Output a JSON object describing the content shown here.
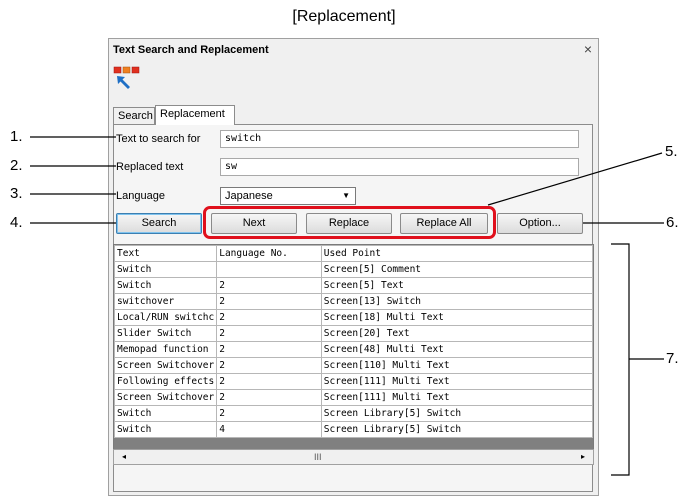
{
  "caption": "[Replacement]",
  "dialog": {
    "title": "Text Search and Replacement",
    "close_symbol": "×",
    "tabs": [
      "Search",
      "Replacement"
    ]
  },
  "form": {
    "search_label": "Text to search for",
    "search_value": "switch",
    "replaced_label": "Replaced text",
    "replaced_value": "sw",
    "language_label": "Language",
    "language_value": "Japanese"
  },
  "buttons": {
    "search": "Search",
    "next": "Next",
    "replace": "Replace",
    "replace_all": "Replace All",
    "option": "Option..."
  },
  "table": {
    "headers": [
      "Text",
      "Language No.",
      "Used Point"
    ],
    "rows": [
      [
        "Switch",
        "",
        "Screen[5] Comment"
      ],
      [
        "Switch",
        "2",
        "Screen[5] Text"
      ],
      [
        "switchover",
        "2",
        "Screen[13] Switch"
      ],
      [
        "Local/RUN switchc",
        "2",
        "Screen[18] Multi Text"
      ],
      [
        "Slider Switch",
        "2",
        "Screen[20] Text"
      ],
      [
        "Memopad function",
        "2",
        "Screen[48] Multi Text"
      ],
      [
        "Screen Switchover",
        "2",
        "Screen[110] Multi Text"
      ],
      [
        "Following effects",
        "2",
        "Screen[111] Multi Text"
      ],
      [
        "Screen Switchover",
        "2",
        "Screen[111] Multi Text"
      ],
      [
        "Switch",
        "2",
        "Screen Library[5] Switch"
      ],
      [
        "Switch",
        "4",
        "Screen Library[5] Switch"
      ]
    ]
  },
  "scrollbar": {
    "left": "◂",
    "thumb": "III",
    "right": "▸"
  },
  "callouts": [
    "1.",
    "2.",
    "3.",
    "4.",
    "5.",
    "6.",
    "7."
  ],
  "colors": {
    "highlight": "#e0101c",
    "grid_bg": "#808080"
  }
}
